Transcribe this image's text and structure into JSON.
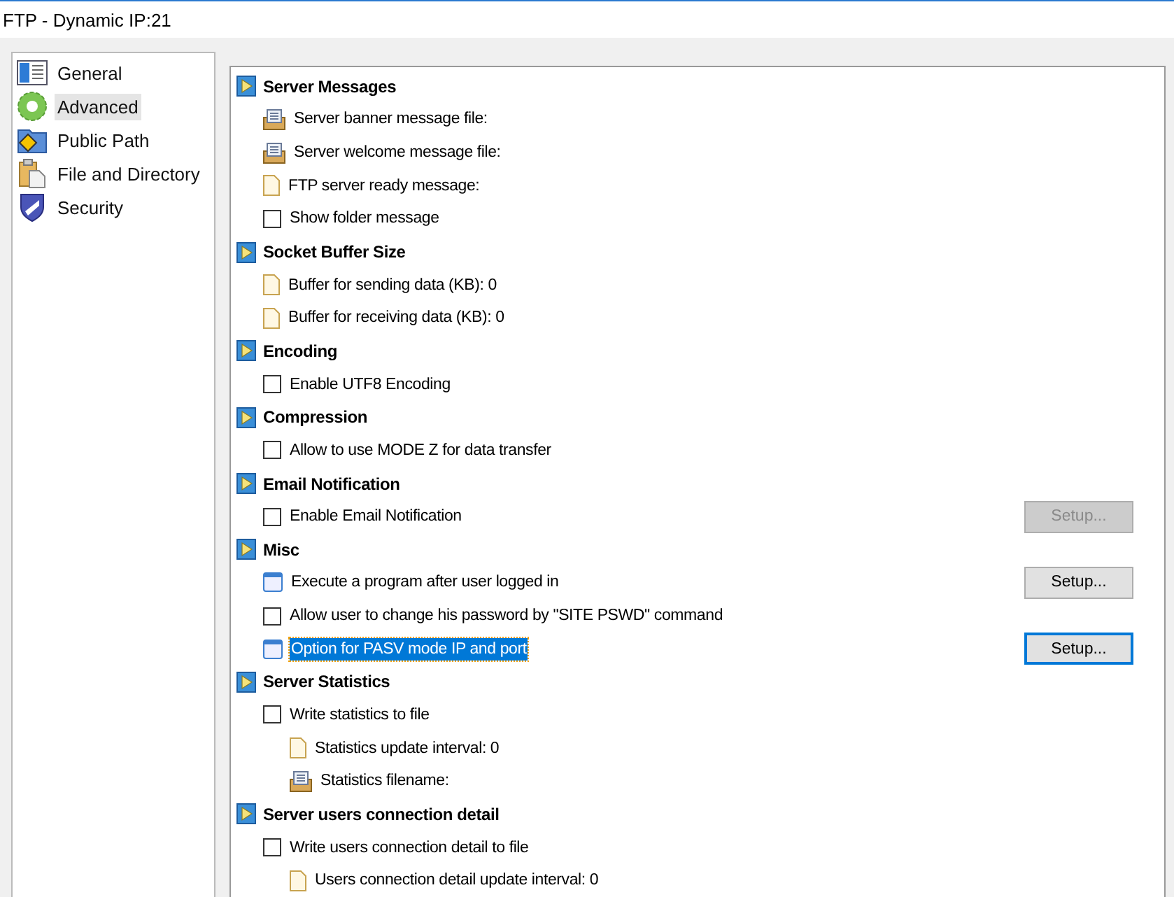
{
  "window": {
    "title": "FTP - Dynamic IP:21"
  },
  "sidebar": {
    "items": [
      {
        "label": "General",
        "kind": "book",
        "selected": false
      },
      {
        "label": "Advanced",
        "kind": "gear",
        "selected": true
      },
      {
        "label": "Public Path",
        "kind": "folder",
        "selected": false
      },
      {
        "label": "File and Directory",
        "kind": "clipboard",
        "selected": false
      },
      {
        "label": "Security",
        "kind": "shield",
        "selected": false
      }
    ]
  },
  "tree": [
    {
      "kind": "section",
      "label": "Server Messages",
      "children": [
        {
          "kind": "msgfile",
          "label": "Server banner message file:"
        },
        {
          "kind": "msgfile",
          "label": "Server welcome message file:"
        },
        {
          "kind": "file",
          "label": "FTP server ready message:"
        },
        {
          "kind": "checkbox",
          "label": "Show folder message",
          "checked": false
        }
      ]
    },
    {
      "kind": "section",
      "label": "Socket Buffer Size",
      "children": [
        {
          "kind": "file",
          "label": "Buffer for sending data (KB): 0"
        },
        {
          "kind": "file",
          "label": "Buffer for receiving data (KB): 0"
        }
      ]
    },
    {
      "kind": "section",
      "label": "Encoding",
      "children": [
        {
          "kind": "checkbox",
          "label": "Enable UTF8 Encoding",
          "checked": false
        }
      ]
    },
    {
      "kind": "section",
      "label": "Compression",
      "children": [
        {
          "kind": "checkbox",
          "label": "Allow to use MODE Z for data transfer",
          "checked": false
        }
      ]
    },
    {
      "kind": "section",
      "label": "Email Notification",
      "children": [
        {
          "kind": "checkbox",
          "label": "Enable Email Notification",
          "checked": false,
          "button": {
            "label": "Setup...",
            "disabled": true,
            "focused": false
          }
        }
      ]
    },
    {
      "kind": "section",
      "label": "Misc",
      "children": [
        {
          "kind": "program",
          "label": "Execute a program after user logged in",
          "selected": false,
          "button": {
            "label": "Setup...",
            "disabled": false,
            "focused": false
          }
        },
        {
          "kind": "checkbox",
          "label": "Allow user to change his password by \"SITE PSWD\" command",
          "checked": false
        },
        {
          "kind": "program",
          "label": "Option for PASV mode IP and port",
          "selected": true,
          "button": {
            "label": "Setup...",
            "disabled": false,
            "focused": true
          }
        }
      ]
    },
    {
      "kind": "section",
      "label": "Server Statistics",
      "children": [
        {
          "kind": "checkbox",
          "label": "Write statistics to file",
          "checked": false,
          "children": [
            {
              "kind": "file",
              "label": "Statistics update interval: 0"
            },
            {
              "kind": "msgfile",
              "label": "Statistics filename:"
            }
          ]
        }
      ]
    },
    {
      "kind": "section",
      "label": "Server users connection detail",
      "children": [
        {
          "kind": "checkbox",
          "label": "Write users connection detail to file",
          "checked": false,
          "children": [
            {
              "kind": "file",
              "label": "Users connection detail update interval: 0"
            }
          ]
        }
      ]
    }
  ]
}
